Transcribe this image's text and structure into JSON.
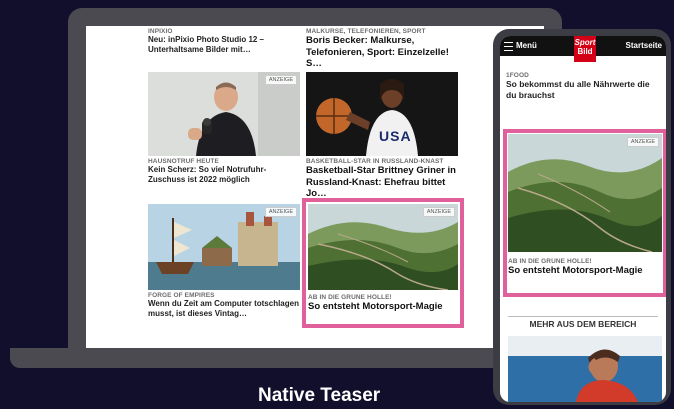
{
  "desktop": {
    "articles": [
      {
        "kicker": "INPIXIO",
        "title": "Neu: inPixio Photo Studio 12 – Unterhaltsame Bilder mit…"
      },
      {
        "kicker": "MALKURSE, TELEFONIEREN, SPORT",
        "title": "Boris Becker: Malkurse, Telefonieren, Sport: Einzelzelle! S…"
      },
      {
        "kicker": "HAUSNOTRUF HEUTE",
        "title": "Kein Scherz: So viel Notrufuhr-Zuschuss ist 2022 möglich",
        "ad": "ANZEIGE"
      },
      {
        "kicker": "BASKETBALL-STAR IN RUSSLAND-KNAST",
        "title": "Basketball-Star Brittney Griner in Russland-Knast: Ehefrau bittet Jo…",
        "jersey": "USA"
      },
      {
        "kicker": "FORGE OF EMPIRES",
        "title": "Wenn du Zeit am Computer totschlagen musst, ist dieses Vintag…",
        "ad": "ANZEIGE"
      },
      {
        "kicker": "AB IN DIE GRÜNE HÖLLE!",
        "title": "So entsteht Motorsport-Magie",
        "ad": "ANZEIGE"
      }
    ]
  },
  "mobile": {
    "menu_label": "Menü",
    "logo_top": "Sport",
    "logo_bottom": "Bild",
    "home_label": "Startseite",
    "article1": {
      "kicker": "1FOOD",
      "title": "So bekommst du alle Nährwerte die du brauchst"
    },
    "ad_label": "ANZEIGE",
    "teaser": {
      "kicker": "AB IN DIE GRÜNE HÖLLE!",
      "title": "So entsteht Motorsport-Magie"
    },
    "section_title": "MEHR AUS DEM BEREICH"
  },
  "caption": "Native Teaser",
  "colors": {
    "highlight": "#e0609c",
    "background": "#120f2c",
    "logo_red": "#d40016"
  }
}
